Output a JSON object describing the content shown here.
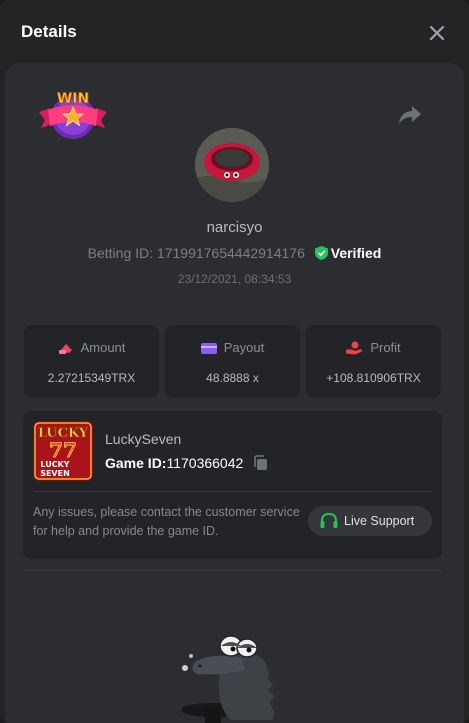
{
  "header": {
    "title": "Details"
  },
  "bet": {
    "username": "narcisyo",
    "betting_id_label": "Betting ID:",
    "betting_id": "1719917654442914176",
    "verified": "Verified",
    "datetime": "23/12/2021, 08:34:53",
    "badge_text": "WIN"
  },
  "stats": {
    "amount": {
      "label": "Amount",
      "value": "2.27215349TRX"
    },
    "payout": {
      "label": "Payout",
      "value": "48.8888 x"
    },
    "profit": {
      "label": "Profit",
      "value": "+108.810906TRX"
    }
  },
  "game": {
    "name": "LuckySeven",
    "id_label": "Game ID:",
    "id": "1170366042",
    "issues_text": "Any issues, please contact the customer service for help and provide the game ID.",
    "support_label": "Live Support",
    "thumb_line1": "LUCKY",
    "thumb_line2": "77",
    "thumb_line3": "LUCKY",
    "thumb_line4": "SEVEN"
  },
  "colors": {
    "accent_green": "#22c55e",
    "amount_icon": "#e8456b",
    "payout_icon": "#8b5cf6",
    "profit_icon": "#ef4444"
  }
}
